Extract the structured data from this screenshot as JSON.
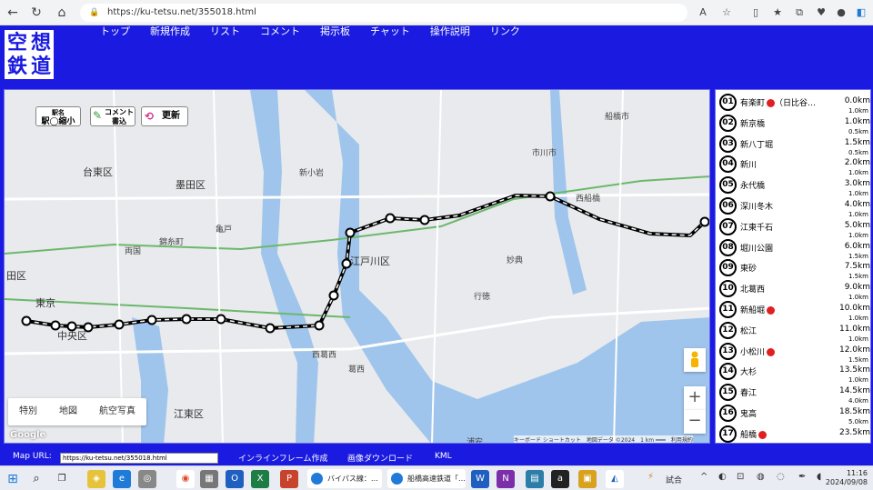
{
  "browser": {
    "url": "https://ku-tetsu.net/355018.html"
  },
  "site": {
    "logo": [
      "空",
      "想",
      "鉄",
      "道"
    ],
    "nav": [
      "トップ",
      "新規作成",
      "リスト",
      "コメント",
      "掲示板",
      "チャット",
      "操作説明",
      "リンク"
    ]
  },
  "map": {
    "btn_station_top": "駅名",
    "btn_station_bottom": "駅◯縮小",
    "btn_comment": "コメント書込",
    "btn_update": "更新",
    "types": [
      "特別",
      "地図",
      "航空写真"
    ],
    "zoom_in": "+",
    "zoom_out": "−",
    "attribution": "キーボード ショートカット　地図データ ©2024　1 km ━━━　利用規約",
    "google": "Google",
    "labels": {
      "taito": "台東区",
      "sumida": "墨田区",
      "tokyo": "東京",
      "chuo": "中央区",
      "edogawa": "江戸川区",
      "koto": "江東区",
      "den": "田区",
      "ichikawa": "市川市",
      "funabashi": "船橋市",
      "nishikasai": "西葛西",
      "kasai": "葛西",
      "urayasu": "浦安",
      "gyotoku": "行徳",
      "myoden": "妙典",
      "nishifunabashi": "西船橋",
      "shinkoiwa": "新小岩",
      "kameido": "亀戸",
      "kinshicho": "錦糸町",
      "ryogoku": "両国"
    }
  },
  "stations": [
    {
      "no": "01",
      "name": "有楽町",
      "extra": "（日比谷…",
      "dot": true,
      "dist": "0.0km",
      "gap": "1.0km"
    },
    {
      "no": "02",
      "name": "新京橋",
      "extra": "",
      "dot": false,
      "dist": "1.0km",
      "gap": "0.5km"
    },
    {
      "no": "03",
      "name": "新八丁堀",
      "extra": "",
      "dot": false,
      "dist": "1.5km",
      "gap": "0.5km"
    },
    {
      "no": "04",
      "name": "新川",
      "extra": "",
      "dot": false,
      "dist": "2.0km",
      "gap": "1.0km"
    },
    {
      "no": "05",
      "name": "永代橋",
      "extra": "",
      "dot": false,
      "dist": "3.0km",
      "gap": "1.0km"
    },
    {
      "no": "06",
      "name": "深川冬木",
      "extra": "",
      "dot": false,
      "dist": "4.0km",
      "gap": "1.0km"
    },
    {
      "no": "07",
      "name": "江東千石",
      "extra": "",
      "dot": false,
      "dist": "5.0km",
      "gap": "1.0km"
    },
    {
      "no": "08",
      "name": "堀川公園",
      "extra": "",
      "dot": false,
      "dist": "6.0km",
      "gap": "1.5km"
    },
    {
      "no": "09",
      "name": "東砂",
      "extra": "",
      "dot": false,
      "dist": "7.5km",
      "gap": "1.5km"
    },
    {
      "no": "10",
      "name": "北葛西",
      "extra": "",
      "dot": false,
      "dist": "9.0km",
      "gap": "1.0km"
    },
    {
      "no": "11",
      "name": "新船堀",
      "extra": "",
      "dot": true,
      "dist": "10.0km",
      "gap": "1.0km"
    },
    {
      "no": "12",
      "name": "松江",
      "extra": "",
      "dot": false,
      "dist": "11.0km",
      "gap": "1.0km"
    },
    {
      "no": "13",
      "name": "小松川",
      "extra": "",
      "dot": true,
      "dist": "12.0km",
      "gap": "1.5km"
    },
    {
      "no": "14",
      "name": "大杉",
      "extra": "",
      "dot": false,
      "dist": "13.5km",
      "gap": "1.0km"
    },
    {
      "no": "15",
      "name": "春江",
      "extra": "",
      "dot": false,
      "dist": "14.5km",
      "gap": "4.0km"
    },
    {
      "no": "16",
      "name": "鬼高",
      "extra": "",
      "dot": false,
      "dist": "18.5km",
      "gap": "5.0km"
    },
    {
      "no": "17",
      "name": "船橋",
      "extra": "",
      "dot": true,
      "dist": "23.5km",
      "gap": ""
    }
  ],
  "footer": {
    "map_url_label": "Map URL:",
    "map_url": "https://ku-tetsu.net/355018.html",
    "links": [
      "インラインフレーム作成",
      "画像ダウンロード",
      "KML"
    ]
  },
  "taskbar": {
    "win1": "バイパス線：…",
    "win2": "船橋高速鉄道「…",
    "weather": "試合",
    "time": "11:16",
    "date": "2024/09/08"
  },
  "colors": {
    "accent": "#1a1ae0",
    "station_dot": "#e02020",
    "green_line": "#4caf50"
  }
}
